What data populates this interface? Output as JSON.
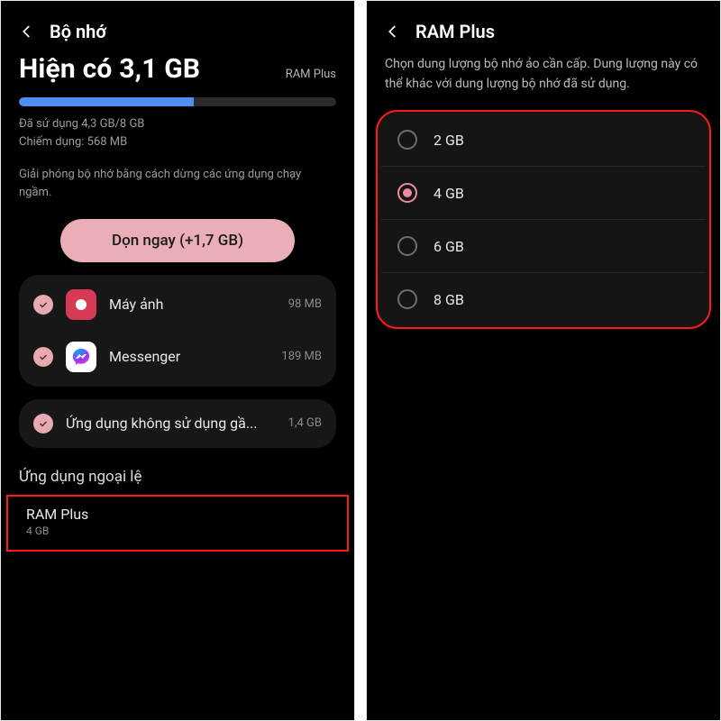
{
  "left": {
    "title": "Bộ nhớ",
    "available": "Hiện có 3,1 GB",
    "ramplus_label": "RAM Plus",
    "used_line": "Đã sử dụng 4,3 GB/8 GB",
    "occupied_line": "Chiếm dụng: 568 MB",
    "hint": "Giải phóng bộ nhớ bằng cách dừng các ứng dụng chạy ngầm.",
    "clean_button": "Dọn ngay (+1,7 GB)",
    "apps": [
      {
        "name": "Máy ảnh",
        "size": "98 MB"
      },
      {
        "name": "Messenger",
        "size": "189 MB"
      },
      {
        "name": "Ứng dụng không sử dụng gầ...",
        "size": "1,4 GB"
      }
    ],
    "section_exceptions": "Ứng dụng ngoại lệ",
    "ramplus_row_title": "RAM Plus",
    "ramplus_row_value": "4 GB"
  },
  "right": {
    "title": "RAM Plus",
    "desc": "Chọn dung lượng bộ nhớ ảo cần cấp. Dung lượng này có thể khác với dung lượng bộ nhớ đã sử dụng.",
    "options": [
      "2 GB",
      "4 GB",
      "6 GB",
      "8 GB"
    ],
    "selected_index": 1
  }
}
